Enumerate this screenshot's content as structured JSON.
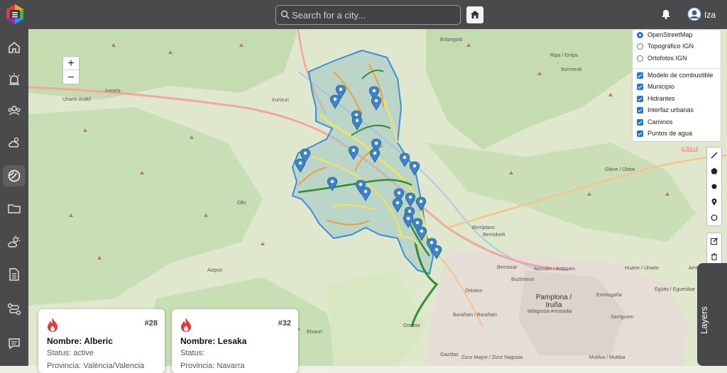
{
  "header": {
    "search_placeholder": "Search for a city...",
    "user_name": "Iza"
  },
  "sidebar": {
    "items": [
      {
        "icon": "home-icon"
      },
      {
        "icon": "alarm-icon"
      },
      {
        "icon": "group-icon"
      },
      {
        "icon": "weather-icon"
      },
      {
        "icon": "fire-map-icon",
        "active": true
      },
      {
        "icon": "folder-icon"
      },
      {
        "icon": "cloud-sun-icon"
      },
      {
        "icon": "document-icon"
      },
      {
        "icon": "route-icon"
      },
      {
        "icon": "chat-icon"
      }
    ]
  },
  "map": {
    "zoom_in": "+",
    "zoom_out": "−",
    "labels": [
      {
        "text": "Eritzegotti"
      },
      {
        "text": "Ripa / Erripa"
      },
      {
        "text": "Iturmendi"
      },
      {
        "text": "Iraneta"
      },
      {
        "text": "Uharte Arakil"
      },
      {
        "text": "Irurtzun"
      },
      {
        "text": "Ollo"
      },
      {
        "text": "Aizpun"
      },
      {
        "text": "Etxauri"
      },
      {
        "text": "Orkoien"
      },
      {
        "text": "Berriozar"
      },
      {
        "text": "Ansoáin / Antsoain"
      },
      {
        "text": "Buztintxuri"
      },
      {
        "text": "Pamplona / Iruña"
      },
      {
        "text": "Huarte / Uharte"
      },
      {
        "text": "Sarriguren"
      },
      {
        "text": "Barañain / Barañain"
      },
      {
        "text": "Milagrosa-Arrosadia"
      },
      {
        "text": "Zizur Mayor / Zizur Nagusia"
      },
      {
        "text": "Mutilva / Mutiloa"
      },
      {
        "text": "Gazólaz"
      },
      {
        "text": "Olave / Olabe"
      },
      {
        "text": "Berriplano"
      },
      {
        "text": "Berriobeiti"
      },
      {
        "text": "Ororbia"
      },
      {
        "text": "Ermitagaña"
      },
      {
        "text": "Egüés / Eguesibar"
      },
      {
        "text": "Arre"
      },
      {
        "text": "N-135"
      }
    ]
  },
  "layers": {
    "base": [
      {
        "label": "OpenStreetMap",
        "selected": true
      },
      {
        "label": "Topográfico IGN",
        "selected": false
      },
      {
        "label": "Ortofotos IGN",
        "selected": false
      }
    ],
    "overlays": [
      {
        "label": "Modelo de combustible",
        "checked": true
      },
      {
        "label": "Municipio",
        "checked": true
      },
      {
        "label": "Hidrantes",
        "checked": true
      },
      {
        "label": "Interfaz urbanas",
        "checked": true
      },
      {
        "label": "Caminos",
        "checked": true
      },
      {
        "label": "Puntos de agua",
        "checked": true
      }
    ]
  },
  "layers_tab": "Layers",
  "cards": [
    {
      "number": "#28",
      "name": "Nombre: Alberic",
      "status": "Status: active",
      "province": "Provincia: València/Valencia"
    },
    {
      "number": "#32",
      "name": "Nombre: Lesaka",
      "status": "Status:",
      "province": "Provincia: Navarra"
    }
  ],
  "colors": {
    "topbar": "#4a4a4c",
    "accent": "#1a73e8",
    "flame": "#e53935",
    "marker": "#3d84c8",
    "municipality": "#3b8de0"
  }
}
